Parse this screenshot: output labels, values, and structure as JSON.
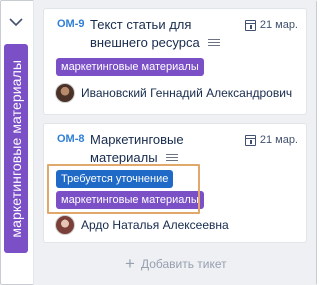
{
  "column": {
    "title": "маркетинговые материалы",
    "accent_color": "#7b50c7",
    "collapse_icon": "chevron-down-icon"
  },
  "cards": [
    {
      "key": "ОМ-9",
      "title": "Текст статьи для внешнего ресурса",
      "date": "21 мар.",
      "tags": [
        "маркетинговые материалы"
      ],
      "assignee": "Ивановский Геннадий Александрович"
    },
    {
      "key": "ОМ-8",
      "title": "Маркетинговые материалы",
      "date": "21 мар.",
      "tags": [
        "Требуется уточнение",
        "маркетинговые материалы"
      ],
      "assignee": "Ардо Наталья Алексеевна"
    }
  ],
  "footer": {
    "add_label": "Добавить тикет"
  }
}
